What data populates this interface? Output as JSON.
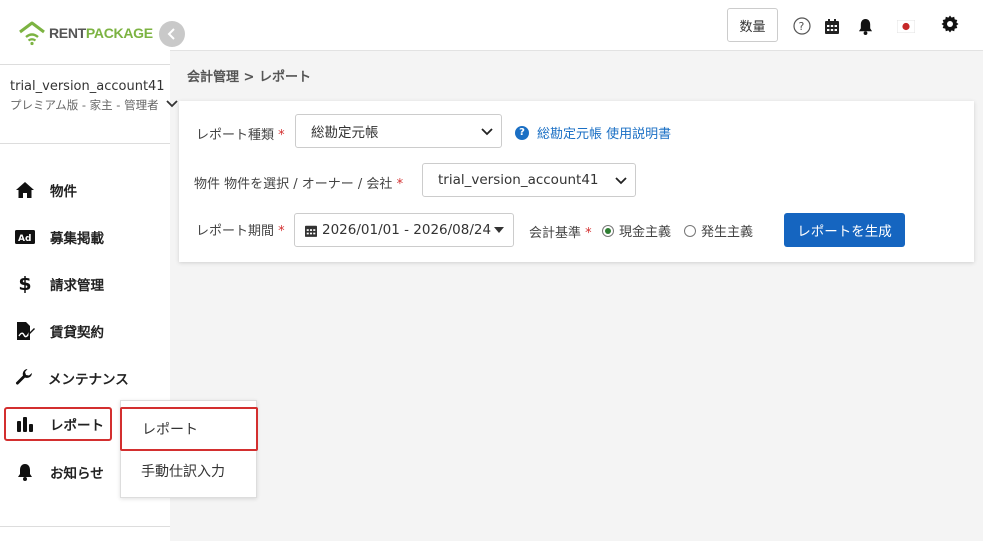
{
  "brand": {
    "name_part1": "RENT",
    "name_part2": "PACKAGE",
    "color_green": "#7cb342"
  },
  "account": {
    "name": "trial_version_account41",
    "plan": "プレミアム版 - 家主 - 管理者"
  },
  "sidebar": {
    "items": [
      {
        "label": "物件",
        "icon": "home-icon"
      },
      {
        "label": "募集掲載",
        "icon": "ad-icon"
      },
      {
        "label": "請求管理",
        "icon": "dollar-icon"
      },
      {
        "label": "賃貸契約",
        "icon": "contract-icon"
      },
      {
        "label": "メンテナンス",
        "icon": "wrench-icon"
      },
      {
        "label": "レポート",
        "icon": "bar-chart-icon",
        "active": true
      },
      {
        "label": "お知らせ",
        "icon": "bell-icon"
      }
    ]
  },
  "submenu": {
    "items": [
      {
        "label": "レポート",
        "active": true
      },
      {
        "label": "手動仕訳入力"
      }
    ]
  },
  "header": {
    "qty_label": "数量",
    "icons": [
      "help-icon",
      "calendar-icon",
      "bell-icon",
      "japan-flag-icon",
      "gear-icon"
    ]
  },
  "breadcrumb": {
    "text": "会計管理 > レポート"
  },
  "form": {
    "report_type": {
      "label": "レポート種類",
      "required": "*",
      "value": "総勘定元帳"
    },
    "help_link": {
      "text": "総勘定元帳 使用説明書"
    },
    "property": {
      "label": "物件 物件を選択 / オーナー / 会社",
      "required": "*",
      "value": "trial_version_account41"
    },
    "period": {
      "label": "レポート期間",
      "required": "*",
      "value": "2026/01/01 - 2026/08/24"
    },
    "basis": {
      "label": "会計基準",
      "required": "*",
      "options": [
        {
          "label": "現金主義",
          "selected": true
        },
        {
          "label": "発生主義",
          "selected": false
        }
      ]
    },
    "generate_button": "レポートを生成"
  },
  "colors": {
    "primary": "#1565c0",
    "required": "#d32f2f",
    "link": "#1a6fc4"
  }
}
